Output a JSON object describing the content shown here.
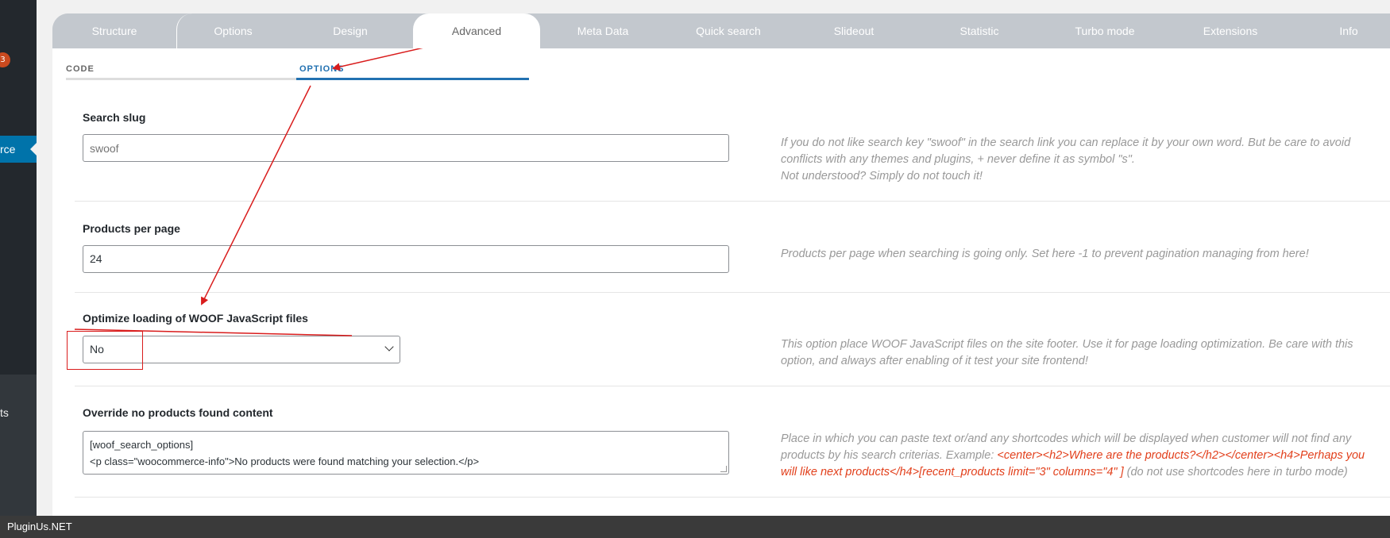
{
  "sidebar": {
    "badge_count": "3",
    "active_item_label": "rce",
    "lower_item_label": "ts"
  },
  "tabs": [
    {
      "label": "Structure"
    },
    {
      "label": "Options"
    },
    {
      "label": "Design"
    },
    {
      "label": "Advanced"
    },
    {
      "label": "Meta Data"
    },
    {
      "label": "Quick search"
    },
    {
      "label": "Slideout"
    },
    {
      "label": "Statistic"
    },
    {
      "label": "Turbo mode"
    },
    {
      "label": "Extensions"
    },
    {
      "label": "Info"
    }
  ],
  "active_tab": "Advanced",
  "subtabs": {
    "code": "CODE",
    "options": "OPTIONS"
  },
  "settings": {
    "search_slug": {
      "label": "Search slug",
      "placeholder": "swoof",
      "description_1": "If you do not like search key \"swoof\" in the search link you can replace it by your own word. But be care to avoid conflicts with any themes and plugins, + never define it as symbol \"s\".",
      "description_2": "Not understood? Simply do not touch it!"
    },
    "products_per_page": {
      "label": "Products per page",
      "value": "24",
      "description": "Products per page when searching is going only. Set here -1 to prevent pagination managing from here!"
    },
    "optimize_js": {
      "label": "Optimize loading of WOOF JavaScript files",
      "value": "No",
      "description": "This option place WOOF JavaScript files on the site footer. Use it for page loading optimization. Be care with this option, and always after enabling of it test your site frontend!"
    },
    "no_products": {
      "label": "Override no products found content",
      "line_1": "[woof_search_options]",
      "line_2": "<p class=\"woocommerce-info\">No products were found matching your selection.</p>",
      "description_a": "Place in which you can paste text or/and any shortcodes which will be displayed when customer will not find any products by his search criterias. Example: ",
      "description_example": "<center><h2>Where are the products?</h2></center><h4>Perhaps you will like next products</h4>[recent_products limit=\"3\" columns=\"4\" ]",
      "description_b": " (do not use shortcodes here in turbo mode)"
    }
  },
  "footer": {
    "text": "PluginUs.NET"
  },
  "colors": {
    "accent": "#2271b1",
    "annotation": "#d91c1c",
    "tab_inactive": "#c3c8ce"
  }
}
